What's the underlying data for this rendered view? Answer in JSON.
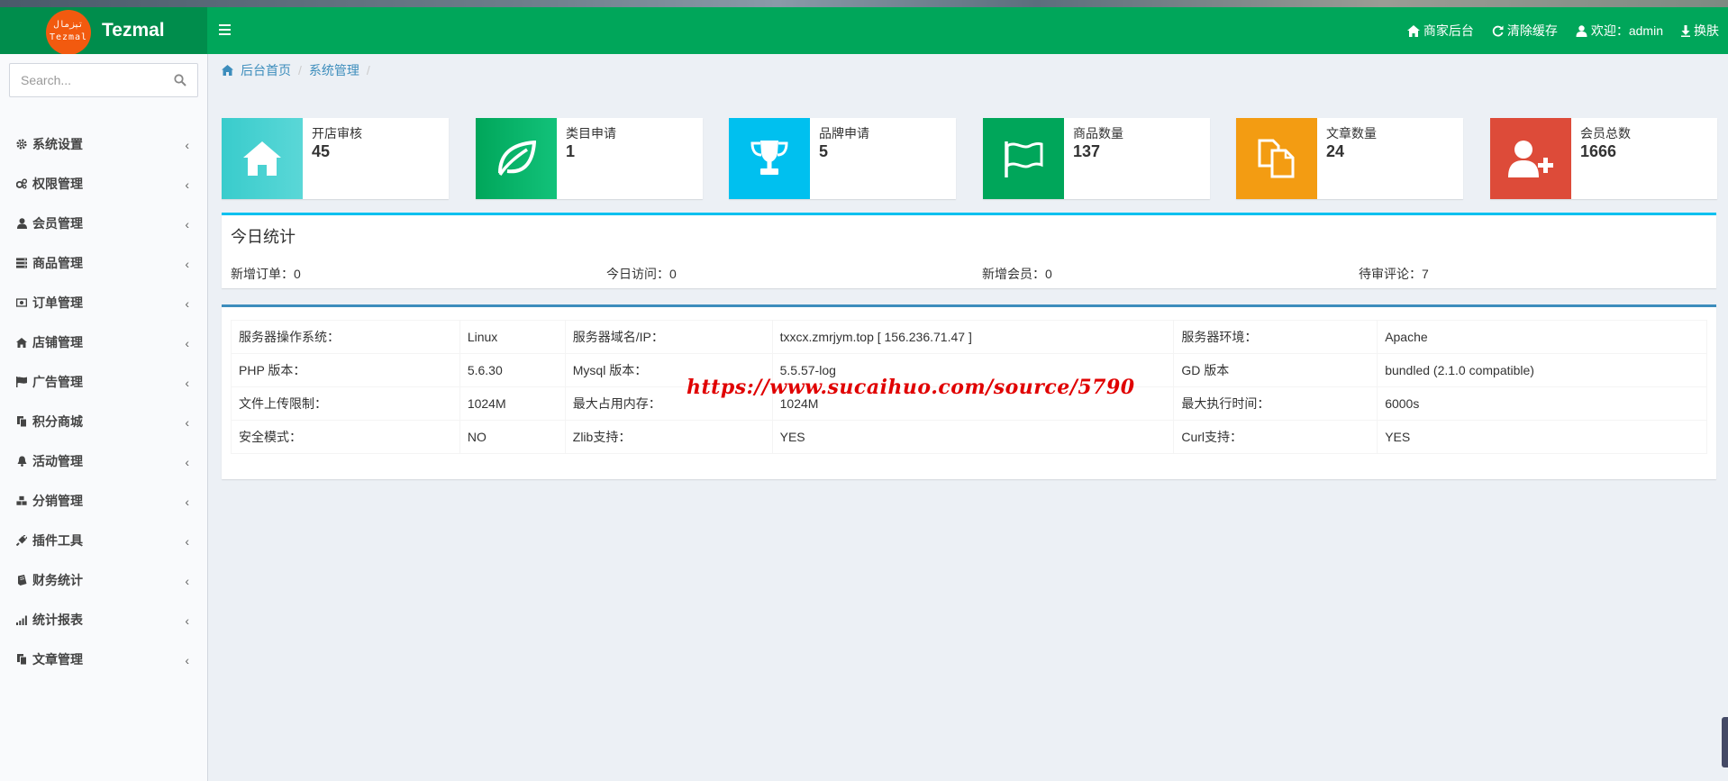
{
  "app": {
    "logo_badge_line1": "تېزمال",
    "logo_badge_line2": "Tezmal",
    "logo_text": "Tezmal"
  },
  "header": {
    "nav": [
      {
        "icon": "home-icon",
        "label": "商家后台"
      },
      {
        "icon": "refresh-icon",
        "label": "清除缓存"
      },
      {
        "icon": "user-icon",
        "label": "欢迎：admin"
      },
      {
        "icon": "download-icon",
        "label": "换肤"
      }
    ]
  },
  "sidebar": {
    "search_placeholder": "Search...",
    "items": [
      {
        "icon": "gear-icon",
        "label": "系统设置"
      },
      {
        "icon": "gears-icon",
        "label": "权限管理"
      },
      {
        "icon": "user-icon",
        "label": "会员管理"
      },
      {
        "icon": "server-icon",
        "label": "商品管理"
      },
      {
        "icon": "money-icon",
        "label": "订单管理"
      },
      {
        "icon": "home-icon",
        "label": "店铺管理"
      },
      {
        "icon": "flag-icon",
        "label": "广告管理"
      },
      {
        "icon": "copy-icon",
        "label": "积分商城"
      },
      {
        "icon": "bell-icon",
        "label": "活动管理"
      },
      {
        "icon": "cubes-icon",
        "label": "分销管理"
      },
      {
        "icon": "plug-icon",
        "label": "插件工具"
      },
      {
        "icon": "book-icon",
        "label": "财务统计"
      },
      {
        "icon": "signal-icon",
        "label": "统计报表"
      },
      {
        "icon": "copy-icon",
        "label": "文章管理"
      }
    ],
    "chevron": "‹"
  },
  "breadcrumb": {
    "home": "后台首页",
    "current": "系统管理",
    "sep": "/"
  },
  "info_boxes": [
    {
      "label": "开店审核",
      "value": "45",
      "color": "#39cccc",
      "icon": "home-icon"
    },
    {
      "label": "类目申请",
      "value": "1",
      "color": "#00a65a",
      "icon": "leaf-icon"
    },
    {
      "label": "品牌申请",
      "value": "5",
      "color": "#00c0ef",
      "icon": "trophy-icon"
    },
    {
      "label": "商品数量",
      "value": "137",
      "color": "#00a65a",
      "icon": "flag-icon"
    },
    {
      "label": "文章数量",
      "value": "24",
      "color": "#f39c12",
      "icon": "copy-icon"
    },
    {
      "label": "会员总数",
      "value": "1666",
      "color": "#dd4b39",
      "icon": "user-plus-icon"
    }
  ],
  "today": {
    "title": "今日统计",
    "stats": [
      "新增订单：0",
      "今日访问：0",
      "新增会员：0",
      "待审评论：7"
    ]
  },
  "server": {
    "rows": [
      [
        "服务器操作系统：",
        "Linux",
        "服务器域名/IP：",
        "txxcx.zmrjym.top [ 156.236.71.47 ]",
        "服务器环境：",
        "Apache"
      ],
      [
        "PHP 版本：",
        "5.6.30",
        "Mysql 版本：",
        "5.5.57-log",
        "GD 版本",
        "bundled (2.1.0 compatible)"
      ],
      [
        "文件上传限制：",
        "1024M",
        "最大占用内存：",
        "1024M",
        "最大执行时间：",
        "6000s"
      ],
      [
        "安全模式：",
        "NO",
        "Zlib支持：",
        "YES",
        "Curl支持：",
        "YES"
      ]
    ]
  },
  "watermark": "https://www.sucaihuo.com/source/5790",
  "colors": {
    "header": "#00a65a",
    "logo_area": "#008d4c",
    "link": "#3c8dbc",
    "today_border": "#00c0ef",
    "server_border": "#3c8dbc"
  }
}
